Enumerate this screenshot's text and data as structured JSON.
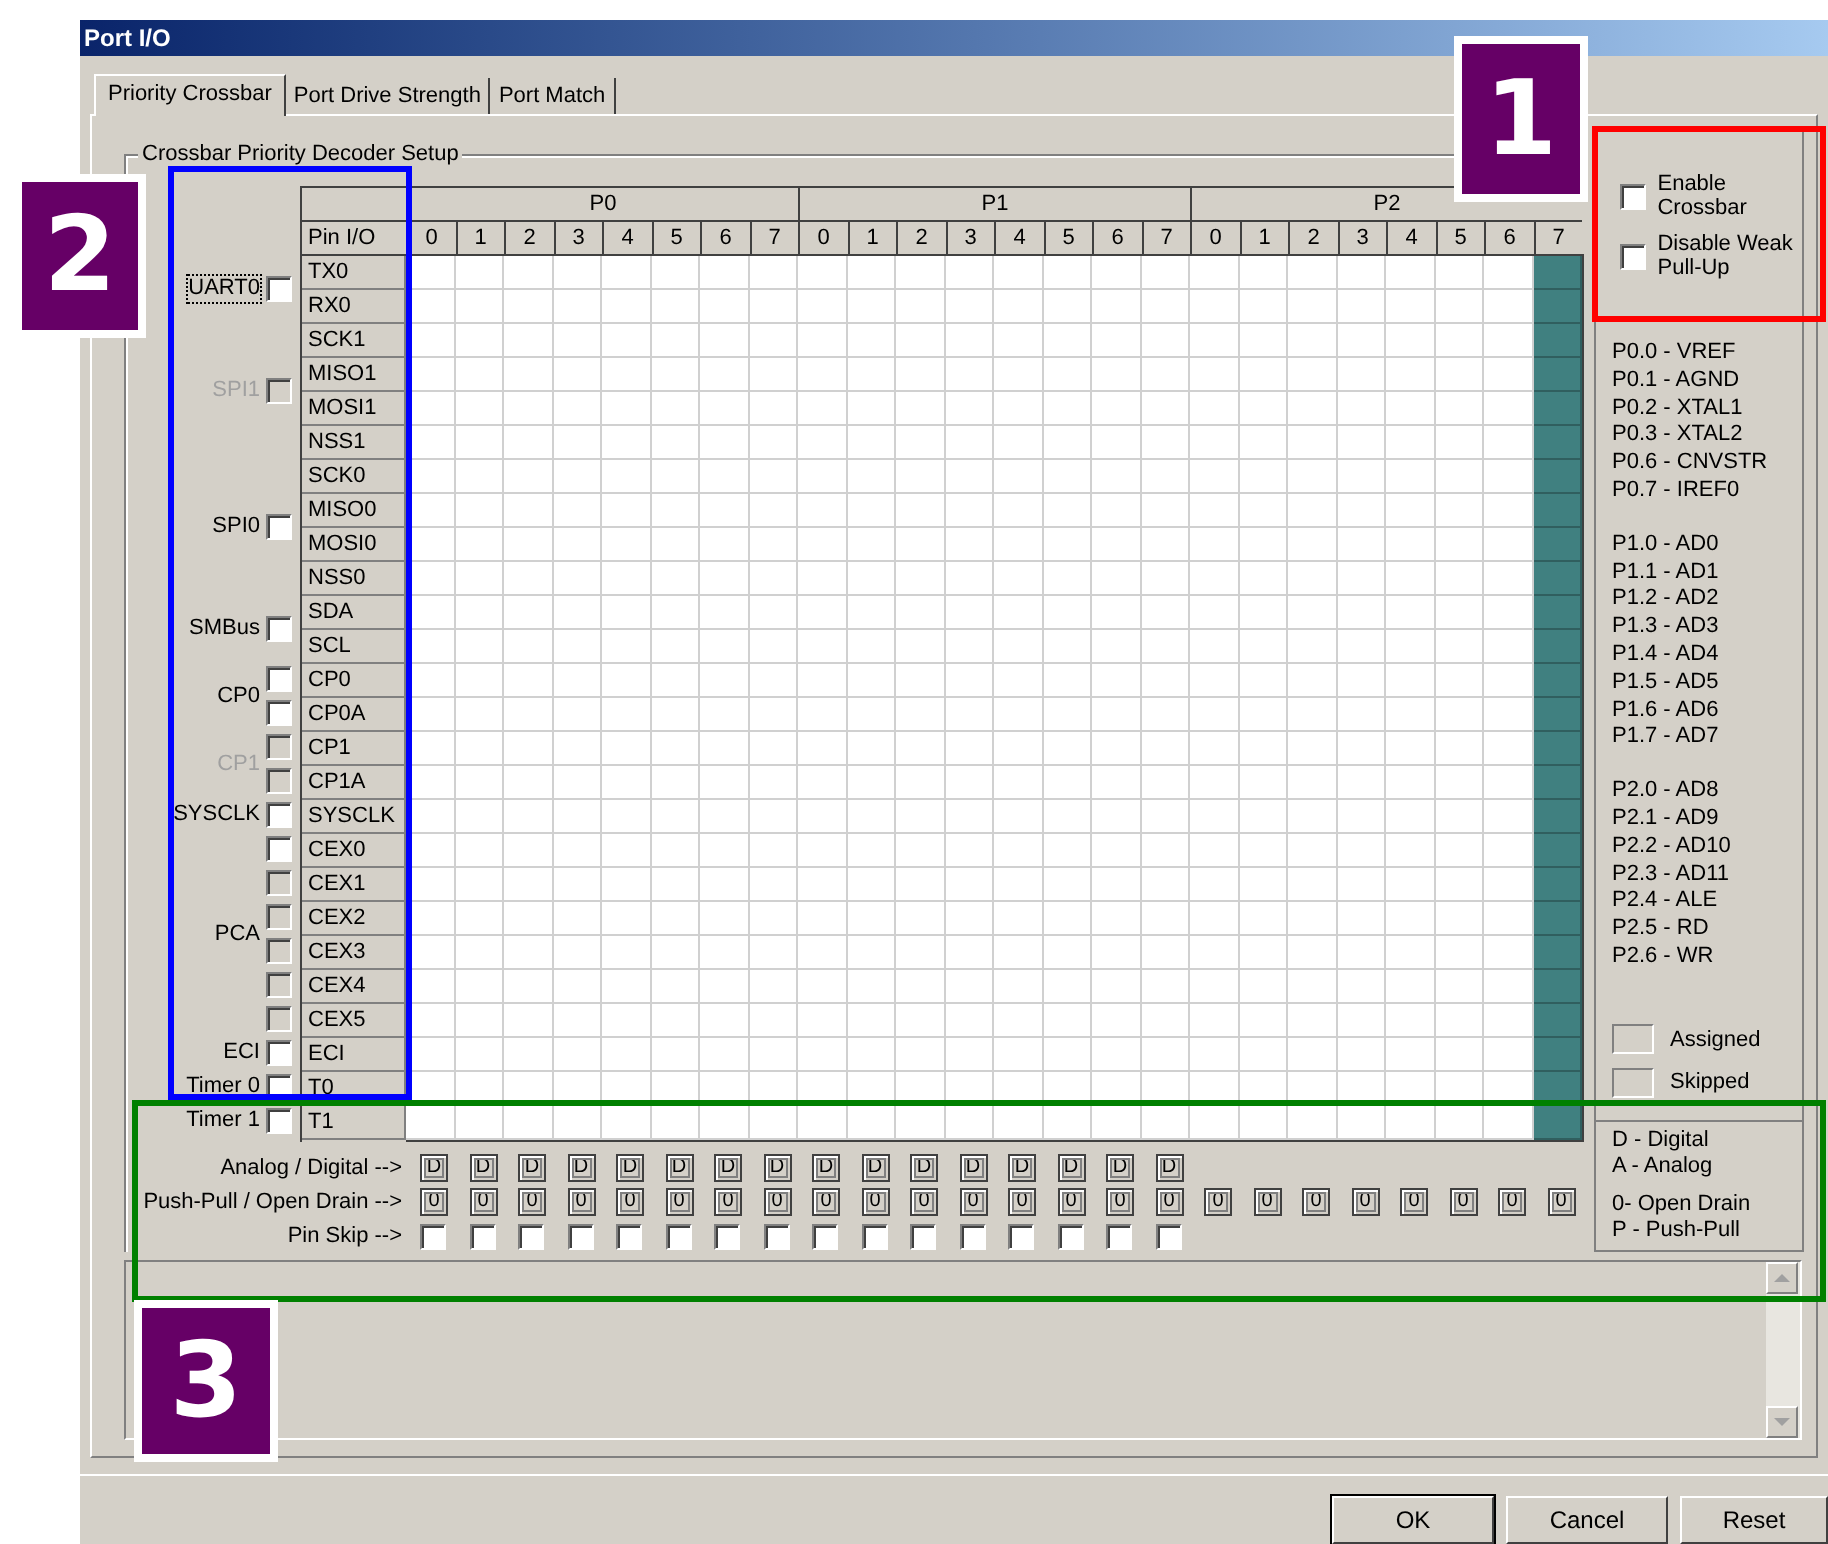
{
  "window": {
    "title": "Port I/O"
  },
  "tabs": [
    {
      "label": "Priority Crossbar",
      "selected": true
    },
    {
      "label": "Port Drive Strength",
      "selected": false
    },
    {
      "label": "Port Match",
      "selected": false
    }
  ],
  "crossbar": {
    "title": "Crossbar Priority Decoder Setup",
    "pin_header": "Pin I/O",
    "ports": [
      {
        "name": "P0",
        "pins": [
          {
            "label": "0",
            "blocked": false
          },
          {
            "label": "1",
            "blocked": false
          },
          {
            "label": "2",
            "blocked": false
          },
          {
            "label": "3",
            "blocked": false
          },
          {
            "label": "4",
            "blocked": false
          },
          {
            "label": "5",
            "blocked": false
          },
          {
            "label": "6",
            "blocked": false
          },
          {
            "label": "7",
            "blocked": false
          }
        ]
      },
      {
        "name": "P1",
        "pins": [
          {
            "label": "0",
            "blocked": false
          },
          {
            "label": "1",
            "blocked": false
          },
          {
            "label": "2",
            "blocked": false
          },
          {
            "label": "3",
            "blocked": false
          },
          {
            "label": "4",
            "blocked": false
          },
          {
            "label": "5",
            "blocked": false
          },
          {
            "label": "6",
            "blocked": false
          },
          {
            "label": "7",
            "blocked": false
          }
        ]
      },
      {
        "name": "P2",
        "pins": [
          {
            "label": "0",
            "blocked": false
          },
          {
            "label": "1",
            "blocked": false
          },
          {
            "label": "2",
            "blocked": false
          },
          {
            "label": "3",
            "blocked": false
          },
          {
            "label": "4",
            "blocked": false
          },
          {
            "label": "5",
            "blocked": false
          },
          {
            "label": "6",
            "blocked": false
          },
          {
            "label": "7",
            "blocked": true
          }
        ]
      }
    ],
    "peripherals": [
      {
        "label": "UART0",
        "disabled": false,
        "focused": true,
        "signals": [
          "TX0",
          "RX0"
        ],
        "checkboxes": [
          {
            "checked": false,
            "disabled": false
          }
        ]
      },
      {
        "label": "SPI1",
        "disabled": true,
        "focused": false,
        "signals": [
          "SCK1",
          "MISO1",
          "MOSI1",
          "NSS1"
        ],
        "checkboxes": [
          {
            "checked": false,
            "disabled": true
          }
        ]
      },
      {
        "label": "SPI0",
        "disabled": false,
        "focused": false,
        "signals": [
          "SCK0",
          "MISO0",
          "MOSI0",
          "NSS0"
        ],
        "checkboxes": [
          {
            "checked": false,
            "disabled": false
          }
        ]
      },
      {
        "label": "SMBus",
        "disabled": false,
        "focused": false,
        "signals": [
          "SDA",
          "SCL"
        ],
        "checkboxes": [
          {
            "checked": false,
            "disabled": false
          }
        ]
      },
      {
        "label": "CP0",
        "disabled": false,
        "focused": false,
        "signals": [
          "CP0",
          "CP0A"
        ],
        "checkboxes": [
          {
            "checked": false,
            "disabled": false
          },
          {
            "checked": false,
            "disabled": false
          }
        ]
      },
      {
        "label": "CP1",
        "disabled": true,
        "focused": false,
        "signals": [
          "CP1",
          "CP1A"
        ],
        "checkboxes": [
          {
            "checked": false,
            "disabled": true
          },
          {
            "checked": false,
            "disabled": true
          }
        ]
      },
      {
        "label": "SYSCLK",
        "disabled": false,
        "focused": false,
        "signals": [
          "SYSCLK"
        ],
        "checkboxes": [
          {
            "checked": false,
            "disabled": false
          }
        ]
      },
      {
        "label": "PCA",
        "disabled": false,
        "focused": false,
        "signals": [
          "CEX0",
          "CEX1",
          "CEX2",
          "CEX3",
          "CEX4",
          "CEX5"
        ],
        "checkboxes": [
          {
            "checked": false,
            "disabled": false
          },
          {
            "checked": false,
            "disabled": true
          },
          {
            "checked": false,
            "disabled": true
          },
          {
            "checked": false,
            "disabled": true
          },
          {
            "checked": false,
            "disabled": true
          },
          {
            "checked": false,
            "disabled": true
          }
        ]
      },
      {
        "label": "ECI",
        "disabled": false,
        "focused": false,
        "signals": [
          "ECI"
        ],
        "checkboxes": [
          {
            "checked": false,
            "disabled": false
          }
        ]
      },
      {
        "label": "Timer 0",
        "disabled": false,
        "focused": false,
        "signals": [
          "T0"
        ],
        "checkboxes": [
          {
            "checked": false,
            "disabled": false
          }
        ]
      },
      {
        "label": "Timer 1",
        "disabled": false,
        "focused": false,
        "signals": [
          "T1"
        ],
        "checkboxes": [
          {
            "checked": false,
            "disabled": false
          }
        ]
      }
    ]
  },
  "pin_settings": [
    {
      "label": "Analog / Digital -->",
      "kind": "toggle",
      "values": [
        "D",
        "D",
        "D",
        "D",
        "D",
        "D",
        "D",
        "D",
        "D",
        "D",
        "D",
        "D",
        "D",
        "D",
        "D",
        "D"
      ]
    },
    {
      "label": "Push-Pull / Open Drain -->",
      "kind": "toggle",
      "values": [
        "0",
        "0",
        "0",
        "0",
        "0",
        "0",
        "0",
        "0",
        "0",
        "0",
        "0",
        "0",
        "0",
        "0",
        "0",
        "0",
        "0",
        "0",
        "0",
        "0",
        "0",
        "0",
        "0",
        "0"
      ]
    },
    {
      "label": "Pin Skip -->",
      "kind": "checkbox",
      "values": [
        {
          "checked": false
        },
        {
          "checked": false
        },
        {
          "checked": false
        },
        {
          "checked": false
        },
        {
          "checked": false
        },
        {
          "checked": false
        },
        {
          "checked": false
        },
        {
          "checked": false
        },
        {
          "checked": false
        },
        {
          "checked": false
        },
        {
          "checked": false
        },
        {
          "checked": false
        },
        {
          "checked": false
        },
        {
          "checked": false
        },
        {
          "checked": false
        },
        {
          "checked": false
        }
      ]
    }
  ],
  "options": [
    {
      "label": "Enable Crossbar",
      "checked": false
    },
    {
      "label": "Disable Weak Pull-Up",
      "checked": false
    }
  ],
  "pin_functions": [
    [
      "P0.0 - VREF",
      "P0.1 - AGND",
      "P0.2 - XTAL1",
      "P0.3 - XTAL2",
      "P0.6 - CNVSTR",
      "P0.7 - IREF0"
    ],
    [
      "P1.0 - AD0",
      "P1.1 - AD1",
      "P1.2 - AD2",
      "P1.3 - AD3",
      "P1.4 - AD4",
      "P1.5 - AD5",
      "P1.6 - AD6",
      "P1.7 - AD7"
    ],
    [
      "P2.0 - AD8",
      "P2.1 - AD9",
      "P2.2 - AD10",
      "P2.3 - AD11",
      "P2.4 - ALE",
      "P2.5 - RD",
      "P2.6 - WR"
    ]
  ],
  "legend": [
    {
      "label": "Assigned"
    },
    {
      "label": "Skipped"
    }
  ],
  "codes": [
    [
      "D - Digital",
      "A - Analog"
    ],
    [
      "0- Open Drain",
      "P - Push-Pull"
    ]
  ],
  "buttons": [
    {
      "label": "OK",
      "default": true
    },
    {
      "label": "Cancel",
      "default": false
    },
    {
      "label": "Reset",
      "default": false
    }
  ],
  "annotation_frames": [
    {
      "color": "#ff0000"
    },
    {
      "color": "#0000ff"
    },
    {
      "color": "#008000"
    }
  ],
  "annotation_badges": [
    {
      "label": "1"
    },
    {
      "label": "2"
    },
    {
      "label": "3"
    }
  ]
}
